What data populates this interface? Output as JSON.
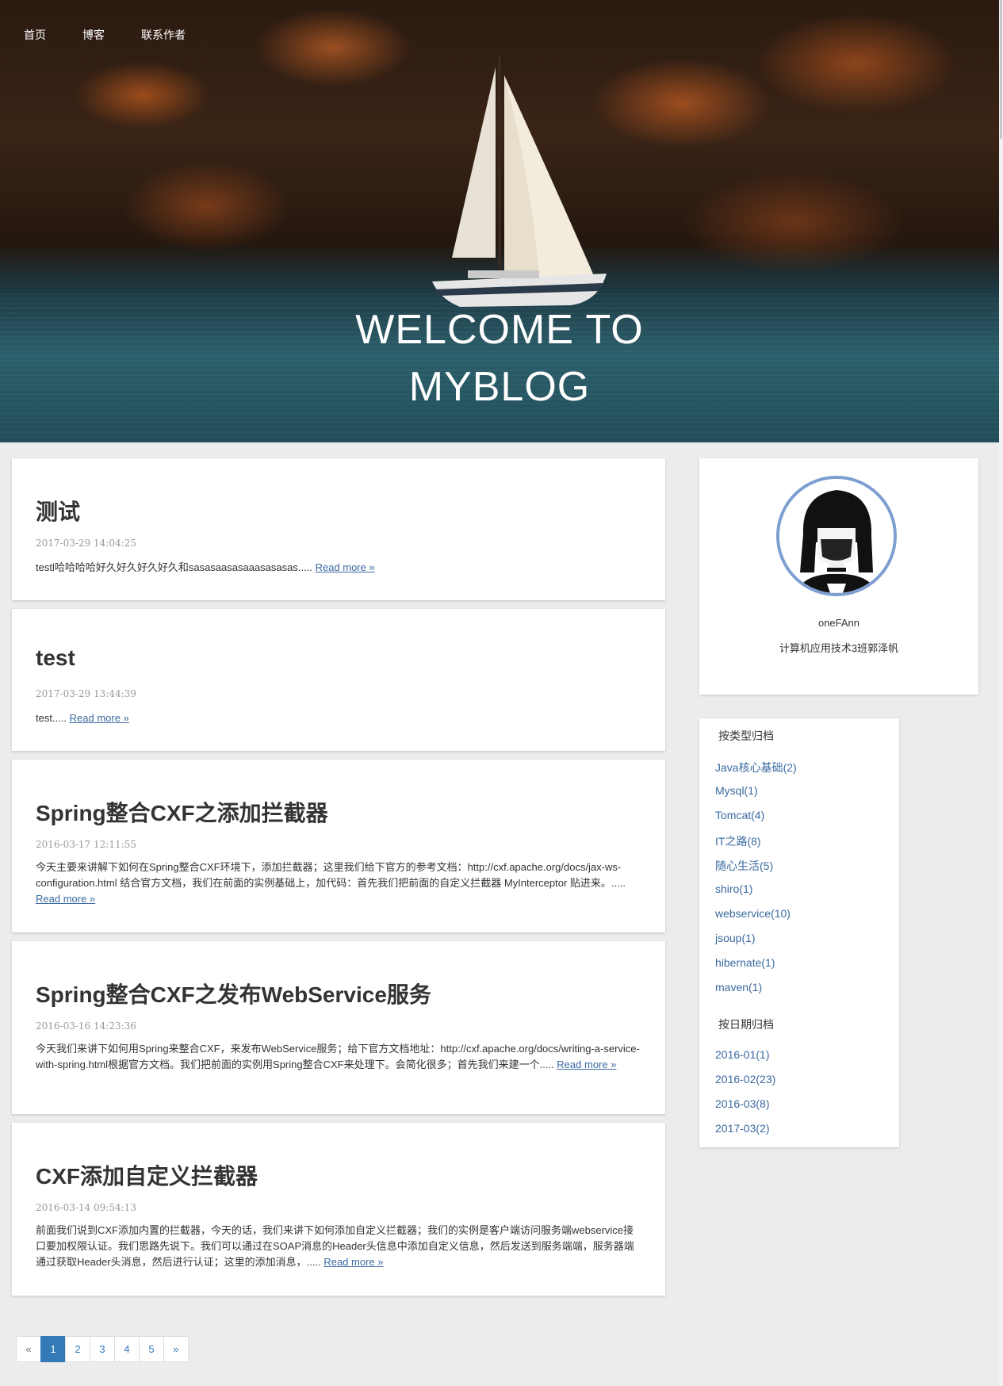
{
  "nav": {
    "items": [
      {
        "label": "首页"
      },
      {
        "label": "博客"
      },
      {
        "label": "联系作者"
      }
    ]
  },
  "hero": {
    "title_line1": "WELCOME TO",
    "title_line2": "MYBLOG"
  },
  "posts": [
    {
      "title": "测试",
      "date": "2017-03-29 14:04:25",
      "excerpt": "testl哈哈哈哈好久好久好久好久和sasasaasasaaasasasas.....",
      "read_more": "Read more »"
    },
    {
      "title": "test",
      "date": "2017-03-29 13:44:39",
      "excerpt": "test.....",
      "read_more": "Read more »"
    },
    {
      "title": "Spring整合CXF之添加拦截器",
      "date": "2016-03-17 12:11:55",
      "excerpt": "今天主要来讲解下如何在Spring整合CXF环境下，添加拦截器；这里我们给下官方的参考文档：http://cxf.apache.org/docs/jax-ws-configuration.html 结合官方文档，我们在前面的实例基础上，加代码：首先我们把前面的自定义拦截器 MyInterceptor 贴进来。.....",
      "read_more": "Read more »"
    },
    {
      "title": "Spring整合CXF之发布WebService服务",
      "date": "2016-03-16 14:23:36",
      "excerpt": "今天我们来讲下如何用Spring来整合CXF，来发布WebService服务；给下官方文档地址：http://cxf.apache.org/docs/writing-a-service-with-spring.html根据官方文档。我们把前面的实例用Spring整合CXF来处理下。会简化很多；首先我们来建一个.....",
      "read_more": "Read more »"
    },
    {
      "title": "CXF添加自定义拦截器",
      "date": "2016-03-14 09:54:13",
      "excerpt": "前面我们说到CXF添加内置的拦截器，今天的话，我们来讲下如何添加自定义拦截器；我们的实例是客户端访问服务端webservice接口要加权限认证。我们思路先说下。我们可以通过在SOAP消息的Header头信息中添加自定义信息，然后发送到服务端端，服务器端通过获取Header头消息，然后进行认证；这里的添加消息，.....",
      "read_more": "Read more »"
    }
  ],
  "profile": {
    "name": "oneFAnn",
    "bio": "计算机应用技术3班郭泽帆"
  },
  "archive": {
    "by_type_heading": "按类型归档",
    "by_type": [
      "Java核心基础(2)",
      "Mysql(1)",
      "Tomcat(4)",
      "IT之路(8)",
      "随心生活(5)",
      "shiro(1)",
      "webservice(10)",
      "jsoup(1)",
      "hibernate(1)",
      "maven(1)"
    ],
    "by_date_heading": "按日期归档",
    "by_date": [
      "2016-01(1)",
      "2016-02(23)",
      "2016-03(8)",
      "2017-03(2)"
    ]
  },
  "pagination": {
    "prev": "«",
    "pages": [
      "1",
      "2",
      "3",
      "4",
      "5"
    ],
    "next": "»",
    "current": "1"
  },
  "colors": {
    "link": "#3a6aa0",
    "active_page": "#337ab7",
    "page_bg": "#ececec"
  }
}
